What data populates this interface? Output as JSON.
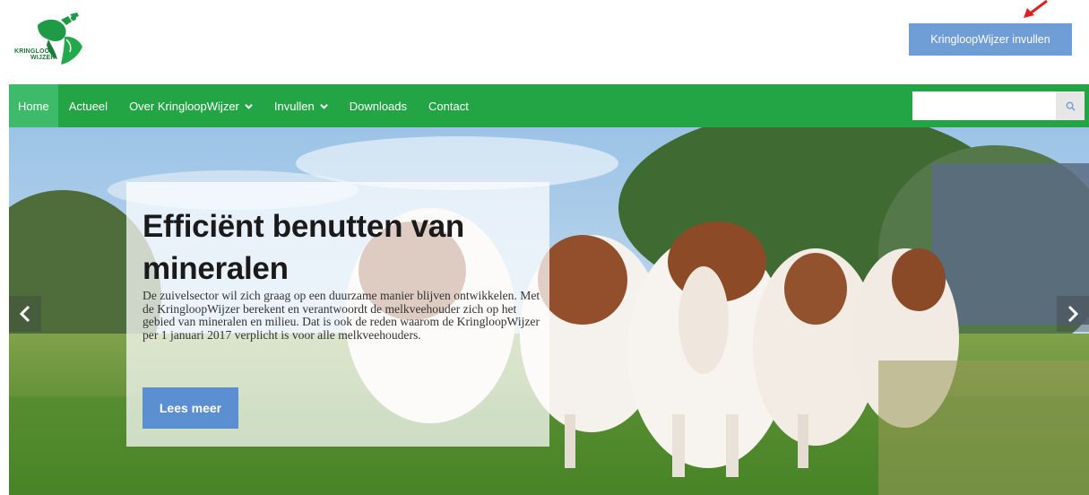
{
  "logo": {
    "line1": "KRINGLOOP",
    "line2": "WIJZER"
  },
  "header": {
    "cta_label": "KringloopWijzer invullen"
  },
  "nav": {
    "items": [
      {
        "label": "Home",
        "active": true
      },
      {
        "label": "Actueel"
      },
      {
        "label": "Over KringloopWijzer",
        "dropdown": true
      },
      {
        "label": "Invullen",
        "dropdown": true
      },
      {
        "label": "Downloads"
      },
      {
        "label": "Contact"
      }
    ],
    "search_placeholder": ""
  },
  "hero": {
    "title": "Efficiënt benutten van mineralen",
    "body": "De zuivelsector wil zich graag op een duurzame manier blijven ontwikkelen. Met de KringloopWijzer berekent en verantwoordt de melkveehouder zich op het gebied van mineralen en milieu. Dat is ook de reden waarom de KringloopWijzer per 1 januari 2017 verplicht is voor alle melkveehouders.",
    "button_label": "Lees meer"
  },
  "colors": {
    "nav_green": "#23a445",
    "nav_active": "#3dba6a",
    "cta_blue": "#6f9ed6",
    "button_blue": "#5b8fd1",
    "annotation_red": "#e02020"
  },
  "icons": [
    "logo-icon",
    "chevron-down-icon",
    "search-icon",
    "chevron-left-icon",
    "chevron-right-icon",
    "arrow-annotation-icon"
  ]
}
